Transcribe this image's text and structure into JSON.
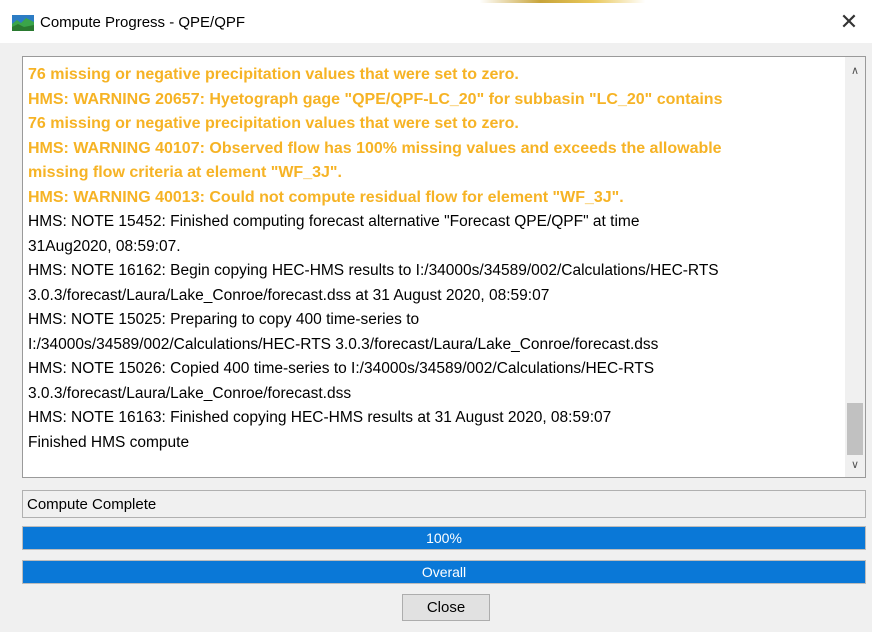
{
  "window": {
    "title": "Compute Progress - QPE/QPF",
    "close_glyph": "✕"
  },
  "log": {
    "lines": [
      {
        "type": "warning",
        "text": "76 missing or negative precipitation values that were set to zero."
      },
      {
        "type": "warning",
        "text": "HMS: WARNING 20657:  Hyetograph gage \"QPE/QPF-LC_20\" for subbasin \"LC_20\" contains"
      },
      {
        "type": "warning",
        "text": "76 missing or negative precipitation values that were set to zero."
      },
      {
        "type": "warning",
        "text": "HMS: WARNING 40107:  Observed flow has 100% missing values and exceeds the allowable"
      },
      {
        "type": "warning",
        "text": "missing flow criteria at element \"WF_3J\"."
      },
      {
        "type": "warning",
        "text": "HMS: WARNING 40013:  Could not compute residual flow for element \"WF_3J\"."
      },
      {
        "type": "note",
        "text": "HMS: NOTE 15452:  Finished computing forecast alternative \"Forecast QPE/QPF\" at time"
      },
      {
        "type": "note",
        "text": "31Aug2020, 08:59:07."
      },
      {
        "type": "note",
        "text": "HMS: NOTE 16162:  Begin copying HEC-HMS results to I:/34000s/34589/002/Calculations/HEC-RTS"
      },
      {
        "type": "note",
        "text": "3.0.3/forecast/Laura/Lake_Conroe/forecast.dss at 31 August 2020, 08:59:07"
      },
      {
        "type": "note",
        "text": "HMS: NOTE 15025:  Preparing to copy 400 time-series to"
      },
      {
        "type": "note",
        "text": "I:/34000s/34589/002/Calculations/HEC-RTS 3.0.3/forecast/Laura/Lake_Conroe/forecast.dss"
      },
      {
        "type": "note",
        "text": "HMS: NOTE 15026:  Copied 400 time-series to I:/34000s/34589/002/Calculations/HEC-RTS"
      },
      {
        "type": "note",
        "text": "3.0.3/forecast/Laura/Lake_Conroe/forecast.dss"
      },
      {
        "type": "note",
        "text": "HMS: NOTE 16163:  Finished copying HEC-HMS results at 31 August 2020, 08:59:07"
      },
      {
        "type": "note",
        "text": "Finished HMS compute"
      }
    ],
    "scroll_up_glyph": "∧",
    "scroll_down_glyph": "∨",
    "scroll_position_fraction": 0.87
  },
  "status": {
    "text": "Compute Complete"
  },
  "progress": {
    "task": {
      "label": "100%",
      "fraction": 1.0
    },
    "overall": {
      "label": "Overall",
      "fraction": 1.0
    }
  },
  "buttons": {
    "close_label": "Close"
  },
  "colors": {
    "warning_text": "#f6b325",
    "progress_fill": "#0a78d7"
  }
}
